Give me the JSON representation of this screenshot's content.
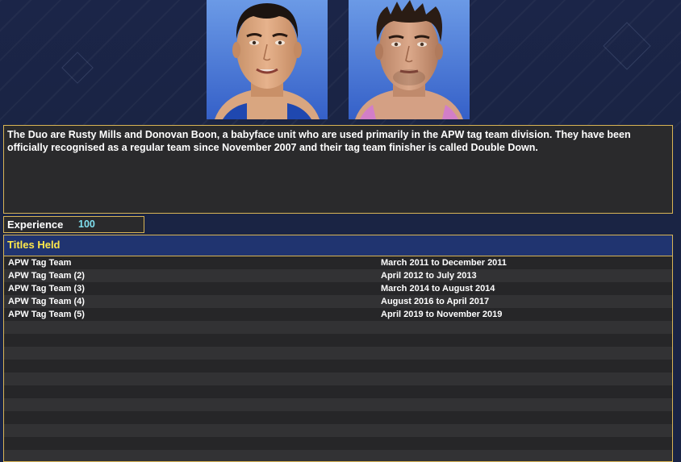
{
  "bio": {
    "text": "The Duo are Rusty Mills and Donovan Boon, a babyface unit who are used primarily in the APW tag team division. They have been officially recognised as a regular team since November 2007 and their tag team finisher is called Double Down."
  },
  "experience": {
    "label": "Experience",
    "value": "100"
  },
  "titles": {
    "header": "Titles Held",
    "rows": [
      {
        "title": "APW Tag Team",
        "dates": "March 2011 to December 2011"
      },
      {
        "title": "APW Tag Team (2)",
        "dates": "April 2012 to July 2013"
      },
      {
        "title": "APW Tag Team (3)",
        "dates": "March 2014 to August 2014"
      },
      {
        "title": "APW Tag Team (4)",
        "dates": "August 2016 to April 2017"
      },
      {
        "title": "APW Tag Team (5)",
        "dates": "April 2019 to November 2019"
      }
    ]
  }
}
